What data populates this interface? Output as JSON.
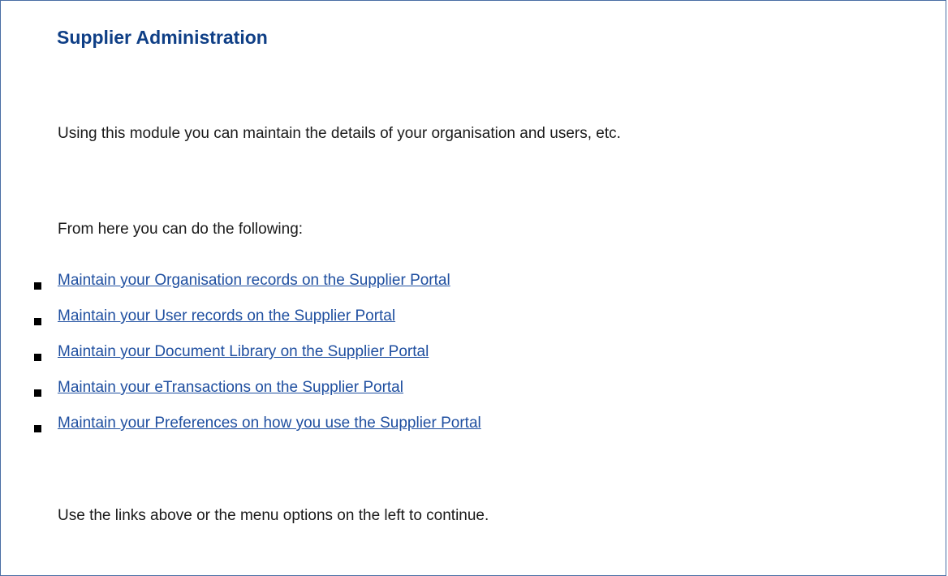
{
  "page": {
    "title": "Supplier Administration",
    "intro": "Using this module you can maintain the details of your organisation and users, etc.",
    "lead": "From here you can do the following:",
    "links": [
      {
        "label": "Maintain your Organisation records on the Supplier Portal"
      },
      {
        "label": "Maintain your User records on the Supplier Portal"
      },
      {
        "label": "Maintain your Document Library on the Supplier Portal"
      },
      {
        "label": "Maintain your eTransactions on the Supplier Portal"
      },
      {
        "label": "Maintain your Preferences on how you use the Supplier Portal"
      }
    ],
    "footer": "Use the links above or the menu options on the left to continue."
  },
  "colors": {
    "title": "#0f3f86",
    "link": "#1f4fa0",
    "border": "#4a6ea5",
    "text": "#1a1a1a"
  }
}
